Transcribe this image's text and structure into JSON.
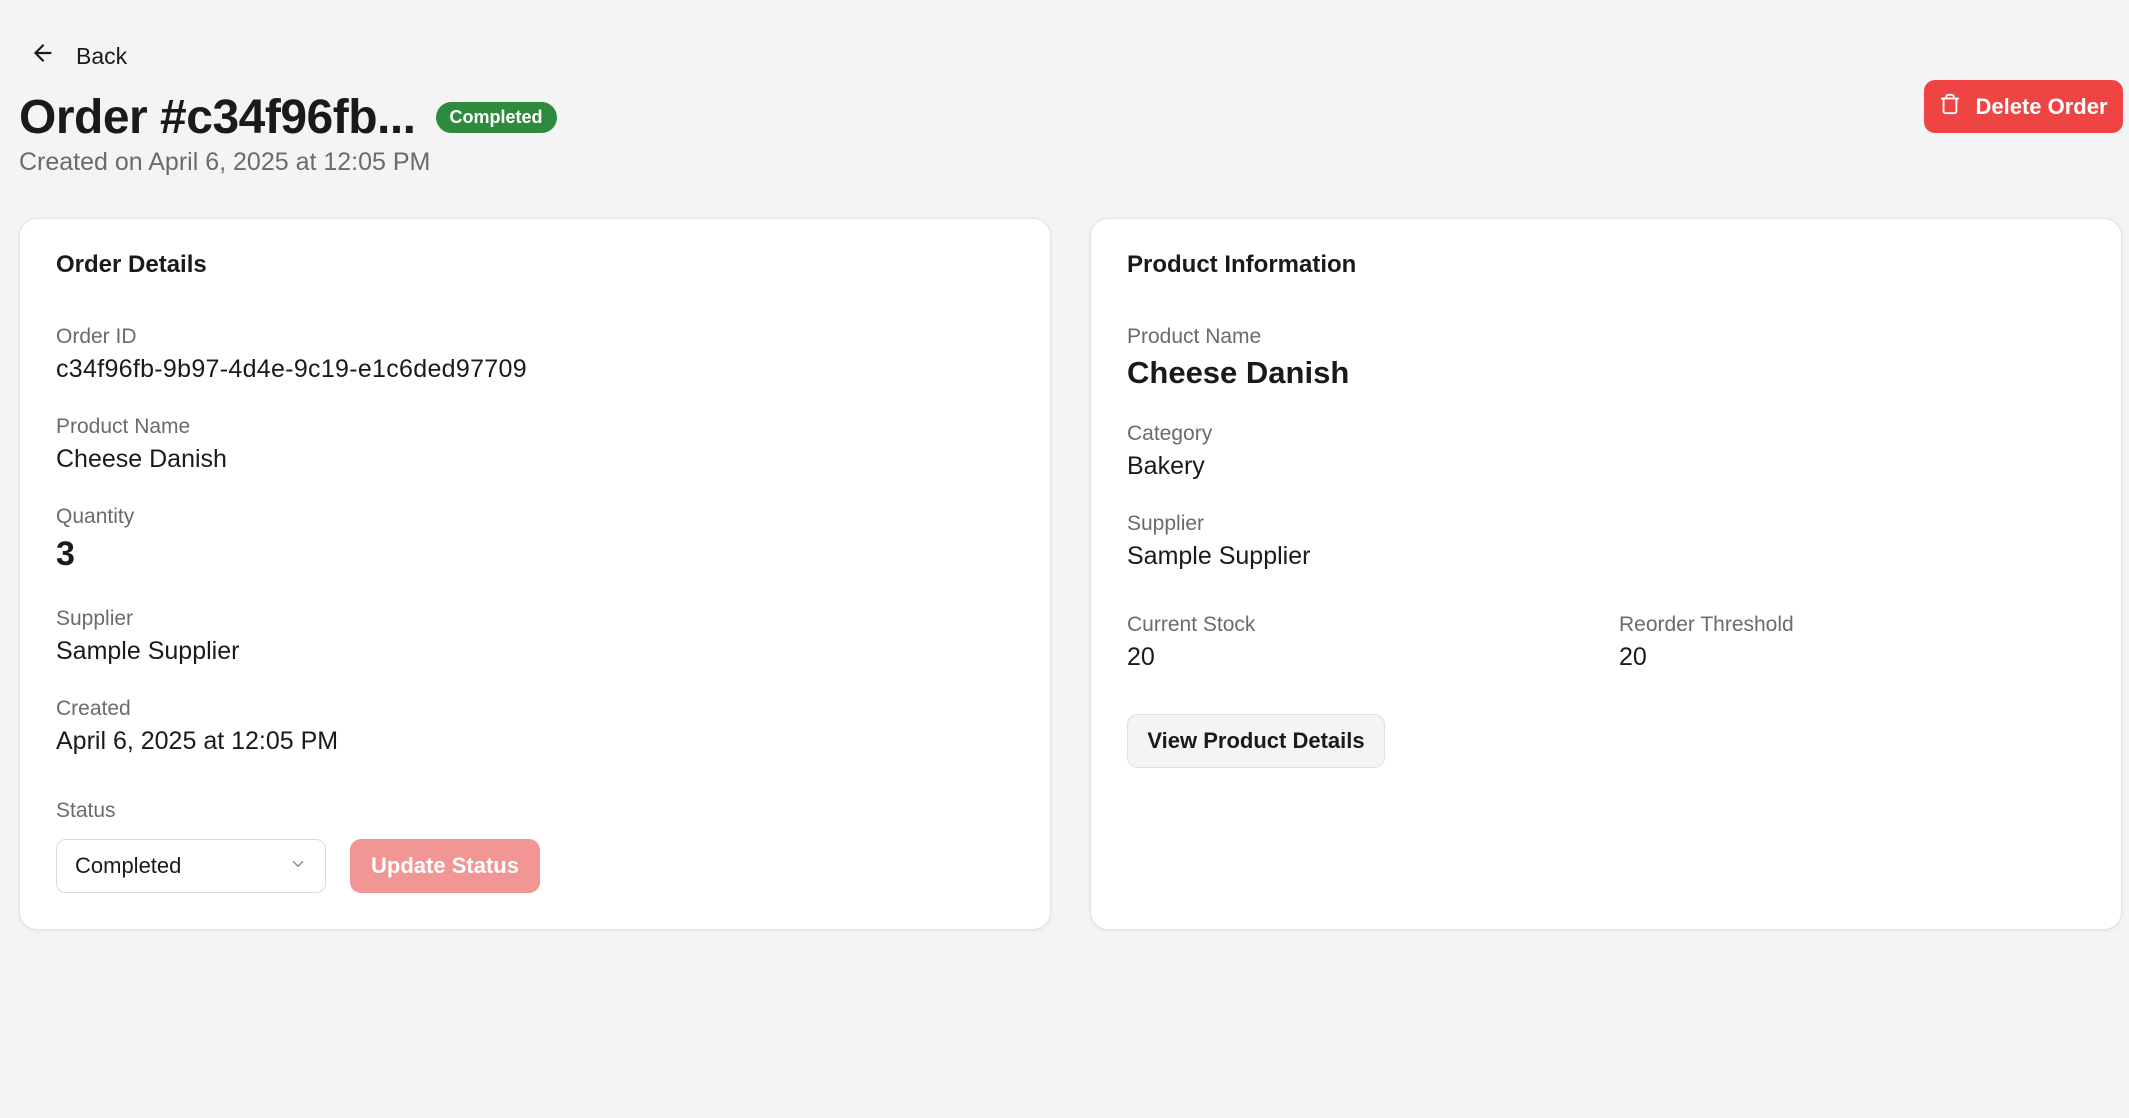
{
  "nav": {
    "back_label": "Back"
  },
  "header": {
    "title": "Order #c34f96fb...",
    "status_badge": "Completed",
    "created_text": "Created on April 6, 2025 at 12:05 PM",
    "delete_label": "Delete Order"
  },
  "order_details": {
    "heading": "Order Details",
    "order_id_label": "Order ID",
    "order_id": "c34f96fb-9b97-4d4e-9c19-e1c6ded97709",
    "product_name_label": "Product Name",
    "product_name": "Cheese Danish",
    "quantity_label": "Quantity",
    "quantity": "3",
    "supplier_label": "Supplier",
    "supplier": "Sample Supplier",
    "created_label": "Created",
    "created": "April 6, 2025 at 12:05 PM",
    "status_label": "Status",
    "status_selected": "Completed",
    "update_label": "Update Status"
  },
  "product_info": {
    "heading": "Product Information",
    "product_name_label": "Product Name",
    "product_name": "Cheese Danish",
    "category_label": "Category",
    "category": "Bakery",
    "supplier_label": "Supplier",
    "supplier": "Sample Supplier",
    "current_stock_label": "Current Stock",
    "current_stock": "20",
    "reorder_threshold_label": "Reorder Threshold",
    "reorder_threshold": "20",
    "view_details_label": "View Product Details"
  },
  "colors": {
    "badge_green": "#2e8b3e",
    "delete_red": "#ef4444",
    "update_disabled": "#f19595",
    "background": "#f4f4f4"
  },
  "icons": {
    "back": "arrow-left-icon",
    "delete": "trash-icon",
    "select": "chevron-down-icon"
  }
}
